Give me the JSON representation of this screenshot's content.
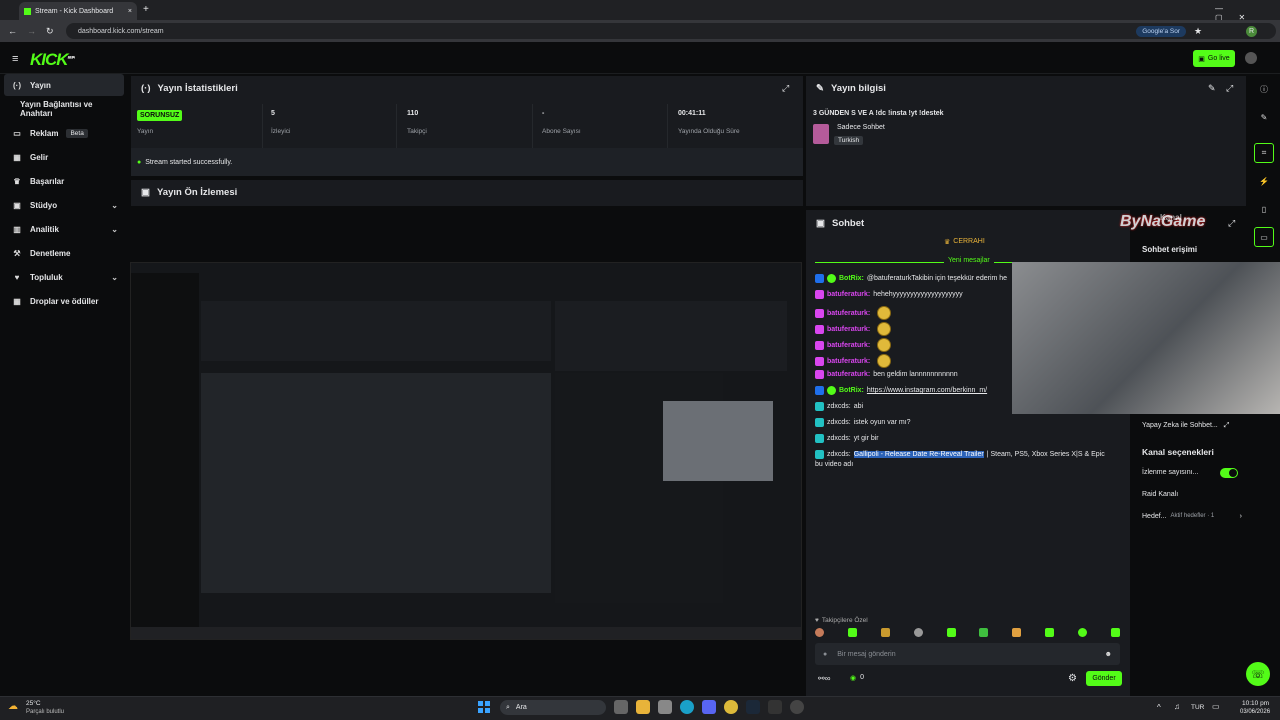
{
  "browser": {
    "tab_title": "Stream - Kick Dashboard",
    "url": "dashboard.kick.com/stream",
    "google_pill": "Google'a Sor",
    "profile_initial": "R"
  },
  "header": {
    "logo": "KICK",
    "logo_sup": "BETA",
    "go_live": "Go live"
  },
  "sidebar": {
    "items": [
      {
        "label": "Yayın",
        "icon": "stream-icon"
      },
      {
        "label": "Yayın Bağlantısı ve Anahtarı",
        "icon": ""
      },
      {
        "label": "Reklam",
        "badge": "Beta",
        "icon": "ad-icon"
      },
      {
        "label": "Gelir",
        "icon": "revenue-icon"
      },
      {
        "label": "Başarılar",
        "icon": "trophy-icon"
      },
      {
        "label": "Stüdyo",
        "icon": "studio-icon"
      },
      {
        "label": "Analitik",
        "icon": "analytics-icon"
      },
      {
        "label": "Denetleme",
        "icon": "moderation-icon"
      },
      {
        "label": "Topluluk",
        "icon": "community-icon"
      },
      {
        "label": "Droplar ve ödüller",
        "icon": "drops-icon"
      }
    ]
  },
  "stats": {
    "title": "Yayın İstatistikleri",
    "items": [
      {
        "value": "SORUNSUZ",
        "label": "Yayın"
      },
      {
        "value": "5",
        "label": "İzleyici"
      },
      {
        "value": "110",
        "label": "Takipçi"
      },
      {
        "value": "-",
        "label": "Abone Sayısı"
      },
      {
        "value": "00:41:11",
        "label": "Yayında Olduğu Süre"
      }
    ],
    "notice": "Stream started successfully."
  },
  "preview": {
    "title": "Yayın Ön İzlemesi"
  },
  "info": {
    "title": "Yayın bilgisi",
    "stream_title": "3 GÜNDEN S VE A !dc !insta !yt !destek",
    "category": "Sadece Sohbet",
    "tag": "Turkish"
  },
  "chat": {
    "title": "Sohbet",
    "pinned": "CERRAHI",
    "new_messages": "Yeni mesajlar",
    "messages": [
      {
        "user": "BotRix:",
        "text": "@batuferaturkTakibin için teşekkür ederim he",
        "color": "#53fc18",
        "bot": true
      },
      {
        "user": "batuferaturk:",
        "text": "hehehyyyyyyyyyyyyyyyyyyyy",
        "color": "#d946ef"
      },
      {
        "user": "batuferaturk:",
        "text": "",
        "emote": true,
        "color": "#d946ef"
      },
      {
        "user": "batuferaturk:",
        "text": "",
        "emote": true,
        "color": "#d946ef"
      },
      {
        "user": "batuferaturk:",
        "text": "",
        "emote": true,
        "color": "#d946ef"
      },
      {
        "user": "batuferaturk:",
        "text": "",
        "emote": true,
        "color": "#d946ef"
      },
      {
        "user": "batuferaturk:",
        "text": "ben geldim lannnnnnnnnnn",
        "color": "#d946ef"
      },
      {
        "user": "BotRix:",
        "text": "https://www.instagram.com/berkinn_m/",
        "color": "#53fc18",
        "bot": true
      },
      {
        "user": "zdxcds:",
        "text": "abi",
        "color": "#22c1c3"
      },
      {
        "user": "zdxcds:",
        "text": "istek oyun var mı?",
        "color": "#22c1c3"
      },
      {
        "user": "zdxcds:",
        "text": "yt gir bir",
        "color": "#22c1c3"
      },
      {
        "user": "zdxcds:",
        "highlight": "Gallipoli - Release Date Re-Reveal Trailer",
        "text": " | Steam, PS5, Xbox Series X|S & Epic",
        "color": "#22c1c3"
      }
    ],
    "wrap_line": "bu video adı",
    "followers_only": "Takipçilere Özel",
    "input_placeholder": "Bir mesaj gönderin",
    "points": "0",
    "send": "Gönder"
  },
  "overlay": {
    "brand": "ByNaGame",
    "kanal": "Kanal",
    "chat_access": "Sohbet erişimi",
    "ai_chat": "Yapay Zeka ile Sohbet...",
    "channel_options": "Kanal seçenekleri",
    "viewer_count": "İzlenme sayısını...",
    "raid": "Raid Kanalı",
    "goals": "Hedef...",
    "goals_active": "Aktif hedefler · 1"
  },
  "taskbar": {
    "temp": "25°C",
    "weather": "Parçalı bulutlu",
    "search": "Ara",
    "lang": "TUR",
    "time": "10:10 pm",
    "date": "03/06/2026"
  },
  "colors": {
    "accent": "#53fc18",
    "panel": "#191b1f",
    "bg": "#0b0c0d"
  }
}
